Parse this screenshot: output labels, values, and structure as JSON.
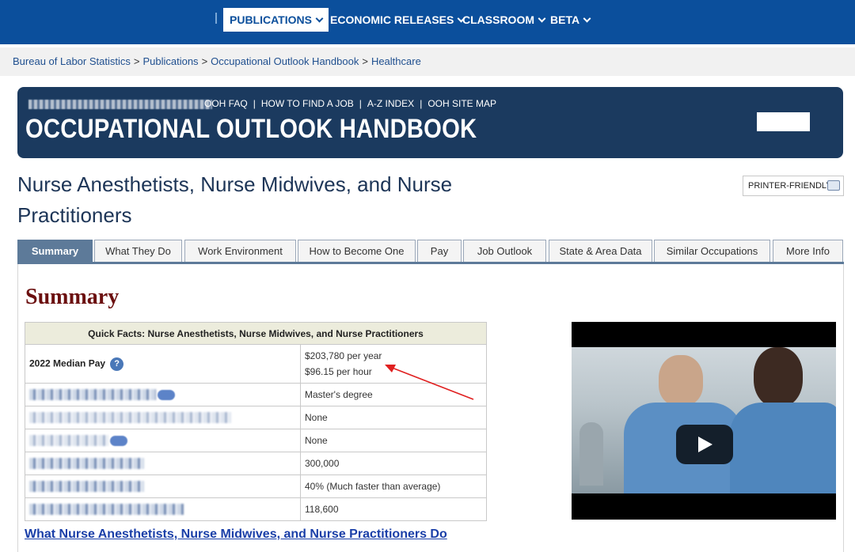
{
  "nav": {
    "items": [
      {
        "label": "PUBLICATIONS",
        "active": true
      },
      {
        "label": "ECONOMIC RELEASES",
        "active": false
      },
      {
        "label": "CLASSROOM",
        "active": false
      },
      {
        "label": "BETA",
        "active": false
      }
    ]
  },
  "breadcrumb": [
    "Bureau of Labor Statistics",
    "Publications",
    "Occupational Outlook Handbook",
    "Healthcare"
  ],
  "banner": {
    "links": [
      "OOH FAQ",
      "HOW TO FIND A JOB",
      "A-Z INDEX",
      "OOH SITE MAP"
    ],
    "title": "OCCUPATIONAL OUTLOOK HANDBOOK"
  },
  "page": {
    "title": "Nurse Anesthetists, Nurse Midwives, and Nurse Practitioners",
    "printer_label": "PRINTER-FRIENDLY"
  },
  "tabs": [
    "Summary",
    "What They Do",
    "Work Environment",
    "How to Become One",
    "Pay",
    "Job Outlook",
    "State & Area Data",
    "Similar Occupations",
    "More Info"
  ],
  "summary": {
    "heading": "Summary",
    "table_title": "Quick Facts: Nurse Anesthetists, Nurse Midwives, and Nurse Practitioners",
    "median_pay_label": "2022 Median Pay",
    "median_pay_year": "$203,780 per year",
    "median_pay_hour": "$96.15 per hour",
    "rows": [
      "Master's degree",
      "None",
      "None",
      "300,000",
      "40% (Much faster than average)",
      "118,600"
    ]
  },
  "link_what_they_do": "What Nurse Anesthetists, Nurse Midwives, and Nurse Practitioners Do",
  "colors": {
    "nav_bg": "#0b4f9c",
    "banner_bg": "#1b3a5f",
    "tab_active": "#5d7a99",
    "heading": "#6b0f0f",
    "arrow": "#e02020"
  }
}
